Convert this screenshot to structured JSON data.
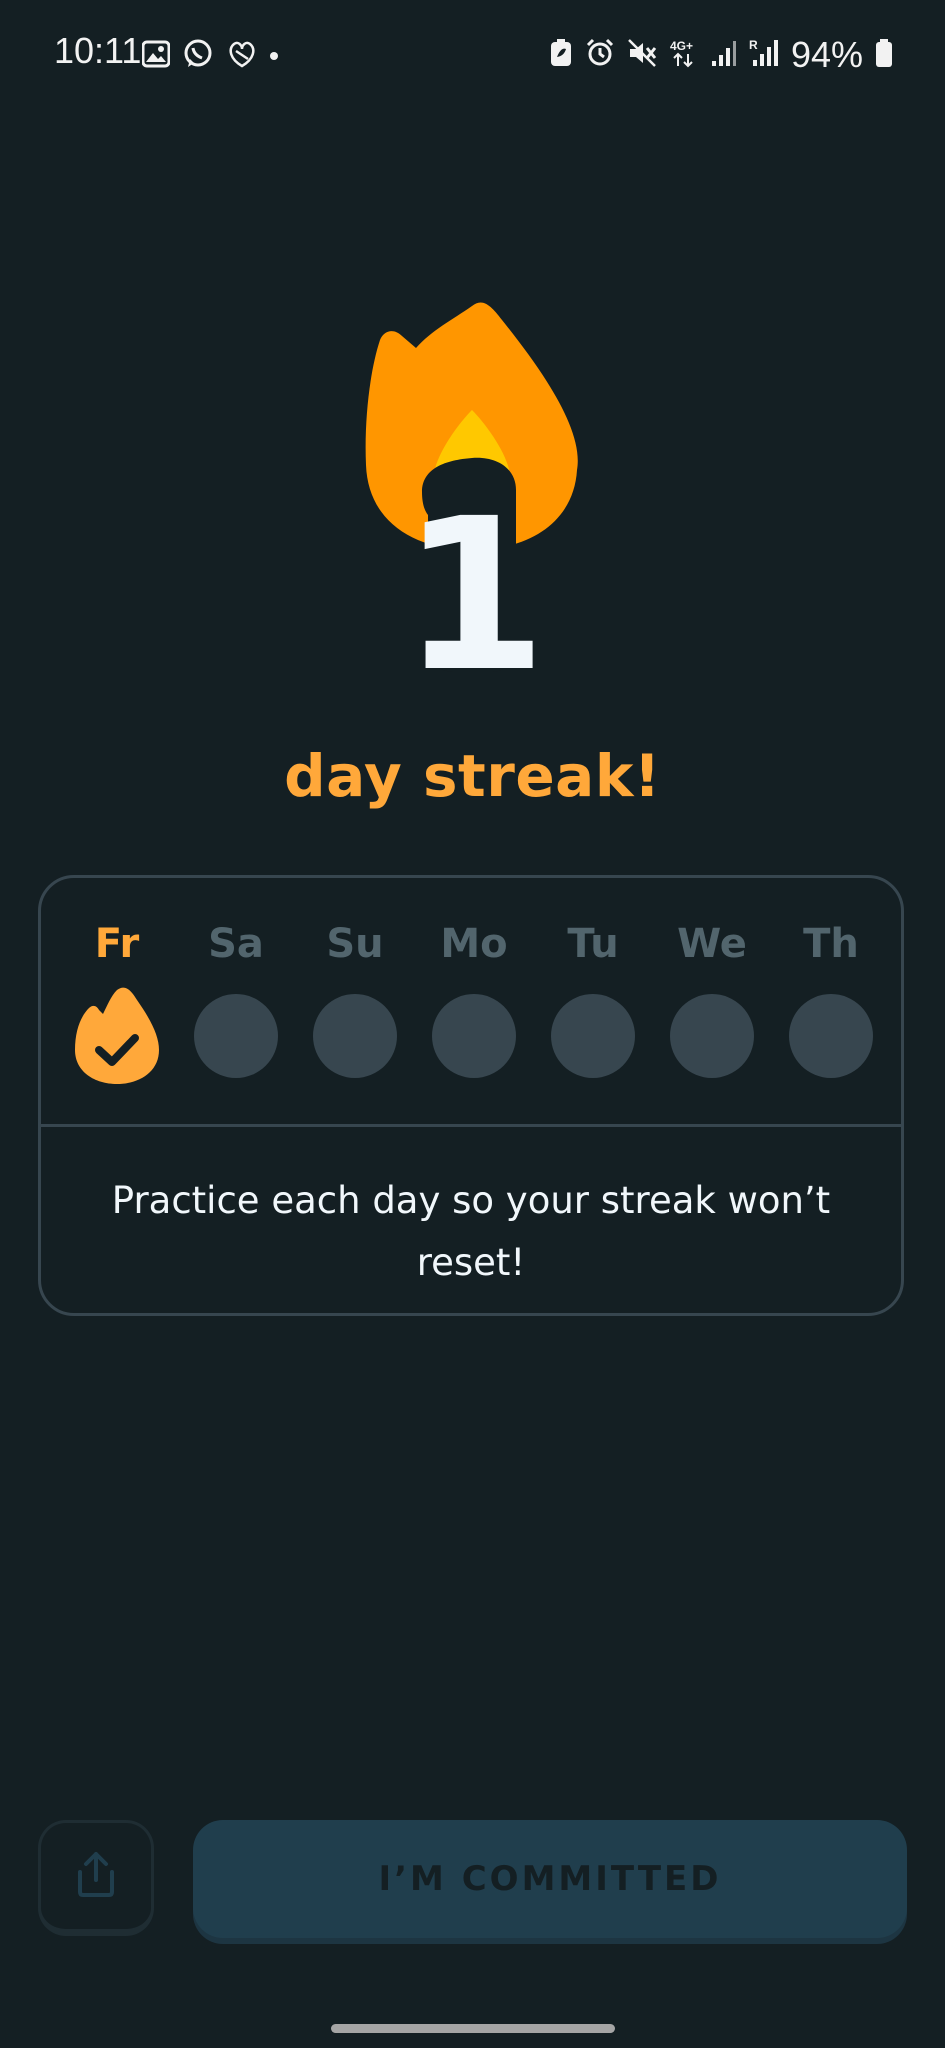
{
  "status_bar": {
    "time": "10:11",
    "battery": "94%",
    "left_icons": [
      "gallery-icon",
      "whatsapp-icon",
      "app-icon",
      "dot"
    ],
    "right_icons": [
      "battery-saver-icon",
      "alarm-icon",
      "mute-icon",
      "4g-icon",
      "signal-icon",
      "signal-roaming-icon",
      "battery-icon"
    ],
    "network": "4G+"
  },
  "hero": {
    "streak_number": "1",
    "flame_colors": {
      "outer": "#ff9600",
      "inner": "#ffc800"
    }
  },
  "streak_title": "day streak!",
  "week": {
    "days": [
      {
        "label": "Fr",
        "completed": true
      },
      {
        "label": "Sa",
        "completed": false
      },
      {
        "label": "Su",
        "completed": false
      },
      {
        "label": "Mo",
        "completed": false
      },
      {
        "label": "Tu",
        "completed": false
      },
      {
        "label": "We",
        "completed": false
      },
      {
        "label": "Th",
        "completed": false
      }
    ],
    "message": "Practice each day so your streak won’t reset!"
  },
  "actions": {
    "share_icon": "share-icon",
    "commit_label": "I’M COMMITTED"
  },
  "colors": {
    "background": "#141f23",
    "accent": "#ffa83a",
    "border": "#37464f",
    "button": "#203e4d"
  }
}
